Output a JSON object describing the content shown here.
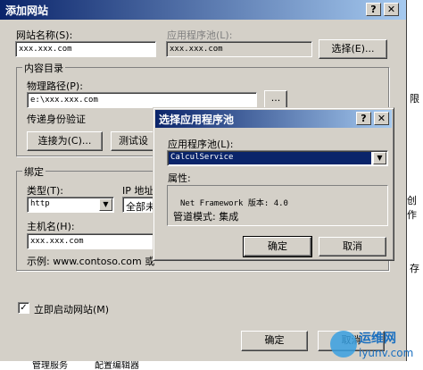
{
  "window": {
    "title": "添加网站",
    "help_btn": "?",
    "close_btn": "✕",
    "site_name_label": "网站名称(S):",
    "site_name_value": "xxx.xxx.com",
    "app_pool_label": "应用程序池(L):",
    "app_pool_value": "xxx.xxx.com",
    "select_button": "选择(E)...",
    "content_group": "内容目录",
    "physical_path_label": "物理路径(P):",
    "physical_path_value": "e:\\xxx.xxx.com",
    "browse_button": "...",
    "passthrough_label": "传递身份验证",
    "connect_as_button": "连接为(C)...",
    "test_settings_button": "测试设",
    "binding_group": "绑定",
    "type_label": "类型(T):",
    "type_value": "http",
    "ip_label": "IP 地址",
    "ip_value": "全部未",
    "host_label": "主机名(H):",
    "host_value": "xxx.xxx.com",
    "example_text": "示例: www.contoso.com 或",
    "start_immediately_label": "立即启动网站(M)",
    "start_immediately_checked": true,
    "ok_button": "确定",
    "cancel_button": "取消"
  },
  "dialog": {
    "title": "选择应用程序池",
    "help_btn": "?",
    "close_btn": "✕",
    "app_pool_label": "应用程序池(L):",
    "app_pool_selected": "CalculService",
    "properties_label": "属性:",
    "framework_line": "Net Framework 版本: 4.0",
    "pipeline_line": "管道模式: 集成",
    "ok_button": "确定",
    "cancel_button": "取消"
  },
  "background_edge": {
    "char_1": "限",
    "char_2": "创作",
    "char_3": "存"
  },
  "taskbar": {
    "item_1": "管理服务",
    "item_2": "配置编辑器"
  },
  "watermark": {
    "text": "运维网",
    "url": "iyunv.com"
  },
  "colors": {
    "title_start": "#0a246a",
    "title_end": "#a6caf0",
    "selection": "#0a246a",
    "face": "#d4d0c8"
  }
}
